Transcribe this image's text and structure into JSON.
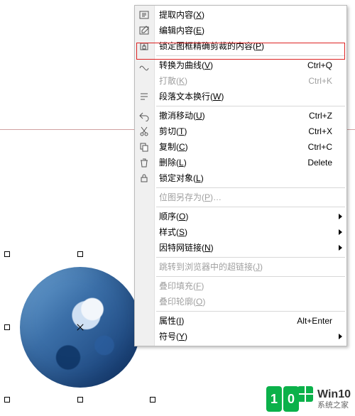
{
  "canvas": {
    "selected_object": "circle-image"
  },
  "menu": {
    "items": [
      {
        "icon": "extract-icon",
        "label": "提取内容(X)",
        "shortcut": "",
        "submenu": false,
        "disabled": false
      },
      {
        "icon": "edit-icon",
        "label": "编辑内容(E)",
        "shortcut": "",
        "submenu": false,
        "disabled": false
      },
      {
        "icon": "lock-crop-icon",
        "label": "锁定图框精确剪裁的内容(P)",
        "shortcut": "",
        "submenu": false,
        "disabled": false,
        "highlighted": true
      }
    ],
    "items2": [
      {
        "icon": "curve-icon",
        "label": "转换为曲线(V)",
        "shortcut": "Ctrl+Q",
        "submenu": false,
        "disabled": false
      },
      {
        "icon": "",
        "label": "打散(K)",
        "shortcut": "Ctrl+K",
        "submenu": false,
        "disabled": true
      },
      {
        "icon": "wrap-icon",
        "label": "段落文本换行(W)",
        "shortcut": "",
        "submenu": false,
        "disabled": false
      }
    ],
    "items3": [
      {
        "icon": "undo-icon",
        "label": "撤消移动(U)",
        "shortcut": "Ctrl+Z",
        "submenu": false,
        "disabled": false
      },
      {
        "icon": "cut-icon",
        "label": "剪切(T)",
        "shortcut": "Ctrl+X",
        "submenu": false,
        "disabled": false
      },
      {
        "icon": "copy-icon",
        "label": "复制(C)",
        "shortcut": "Ctrl+C",
        "submenu": false,
        "disabled": false
      },
      {
        "icon": "delete-icon",
        "label": "删除(L)",
        "shortcut": "Delete",
        "submenu": false,
        "disabled": false
      },
      {
        "icon": "lock-icon",
        "label": "锁定对象(L)",
        "shortcut": "",
        "submenu": false,
        "disabled": false
      }
    ],
    "items4": [
      {
        "icon": "",
        "label": "位图另存为(P)…",
        "shortcut": "",
        "submenu": false,
        "disabled": true
      }
    ],
    "items5": [
      {
        "icon": "",
        "label": "顺序(O)",
        "shortcut": "",
        "submenu": true,
        "disabled": false
      },
      {
        "icon": "",
        "label": "样式(S)",
        "shortcut": "",
        "submenu": true,
        "disabled": false
      },
      {
        "icon": "",
        "label": "因特网链接(N)",
        "shortcut": "",
        "submenu": true,
        "disabled": false
      }
    ],
    "items6": [
      {
        "icon": "",
        "label": "跳转到浏览器中的超链接(J)",
        "shortcut": "",
        "submenu": false,
        "disabled": true
      }
    ],
    "items7": [
      {
        "icon": "",
        "label": "叠印填充(F)",
        "shortcut": "",
        "submenu": false,
        "disabled": true
      },
      {
        "icon": "",
        "label": "叠印轮廓(O)",
        "shortcut": "",
        "submenu": false,
        "disabled": true
      }
    ],
    "items8": [
      {
        "icon": "",
        "label": "属性(I)",
        "shortcut": "Alt+Enter",
        "submenu": false,
        "disabled": false
      },
      {
        "icon": "",
        "label": "符号(Y)",
        "shortcut": "",
        "submenu": true,
        "disabled": false
      }
    ]
  },
  "logo": {
    "line1": "Win10",
    "line2": "系统之家"
  }
}
